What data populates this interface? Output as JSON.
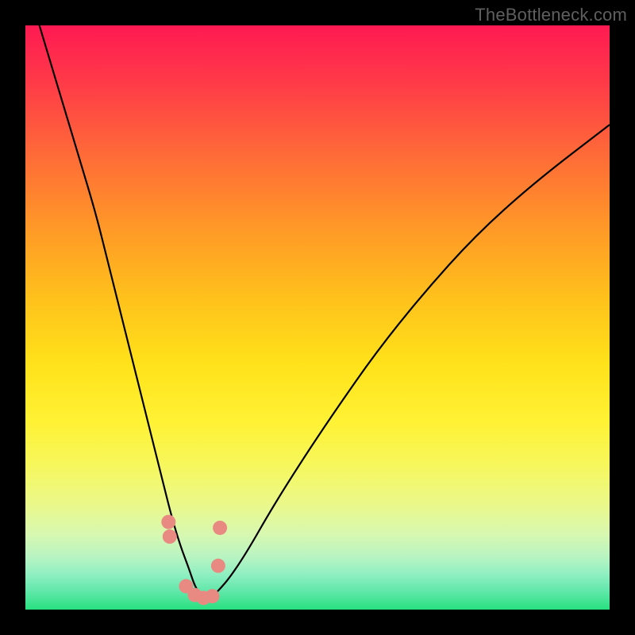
{
  "watermark": "TheBottleneck.com",
  "colors": {
    "frame": "#000000",
    "curve": "#000000",
    "marker": "#e98a82"
  },
  "chart_data": {
    "type": "line",
    "title": "",
    "xlabel": "",
    "ylabel": "",
    "xlim": [
      0,
      100
    ],
    "ylim": [
      0,
      100
    ],
    "x": [
      0,
      3,
      6,
      9,
      12,
      14,
      16,
      18,
      20,
      22,
      23.5,
      25,
      26.5,
      28,
      29,
      30,
      31,
      32,
      33,
      35,
      38,
      42,
      47,
      53,
      60,
      68,
      77,
      87,
      100
    ],
    "values": [
      108,
      98,
      88,
      78,
      68,
      60,
      52,
      44,
      36,
      28,
      22,
      16,
      11,
      7,
      4,
      2.5,
      2,
      2.3,
      3.2,
      5.5,
      10,
      17,
      25,
      34,
      44,
      54,
      64,
      73,
      83
    ],
    "markers": {
      "x": [
        24.5,
        24.7,
        27.5,
        29.0,
        30.5,
        32.0,
        33.0,
        33.3
      ],
      "y": [
        15.0,
        12.5,
        4.0,
        2.5,
        2.0,
        2.3,
        7.5,
        14.0
      ]
    },
    "note": "V-shaped bottleneck curve over a red→green vertical gradient; minimum near x≈31. Axes are unlabeled; values are estimated from pixel positions on a 0–100 normalized scale."
  }
}
